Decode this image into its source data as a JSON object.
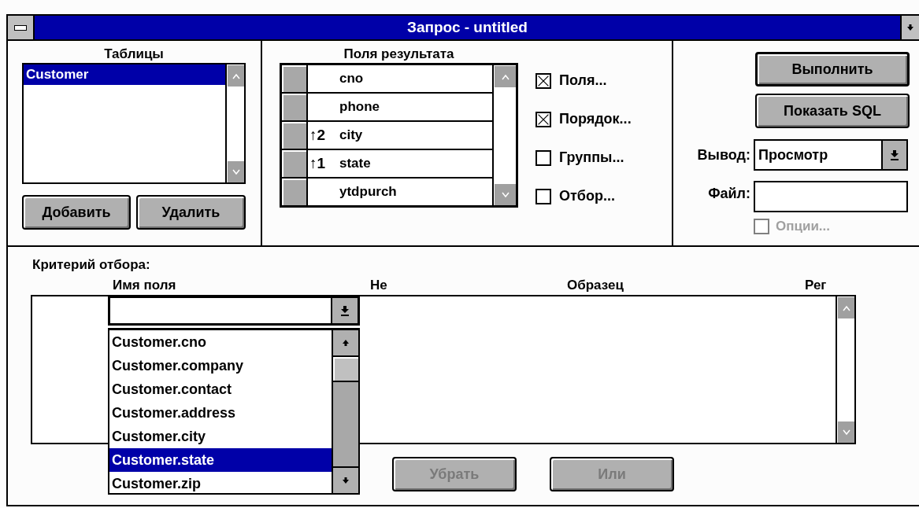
{
  "window": {
    "title": "Запрос - untitled"
  },
  "tables": {
    "label": "Таблицы",
    "items": [
      {
        "name": "Customer",
        "selected": true
      }
    ],
    "buttons": [
      {
        "label": "Добавить"
      },
      {
        "label": "Удалить"
      }
    ]
  },
  "result_fields": {
    "label": "Поля результата",
    "rows": [
      {
        "name": "cno"
      },
      {
        "name": "phone"
      },
      {
        "sort": "↑2",
        "name": "city"
      },
      {
        "sort": "↑1",
        "name": "state"
      },
      {
        "name": "ytdpurch"
      }
    ]
  },
  "options": [
    {
      "label": "Поля...",
      "checked": true
    },
    {
      "label": "Порядок...",
      "checked": true
    },
    {
      "label": "Группы...",
      "checked": false
    },
    {
      "label": "Отбор...",
      "checked": false
    }
  ],
  "actions": [
    {
      "label": "Выполнить",
      "default": true
    },
    {
      "label": "Показать SQL",
      "default": false
    }
  ],
  "output": {
    "label": "Вывод:",
    "value": "Просмотр"
  },
  "file": {
    "label": "Файл:"
  },
  "file_options": {
    "label": "Опции...",
    "checked": false,
    "disabled": true
  },
  "criteria": {
    "label": "Критерий отбора:",
    "columns": [
      "Имя поля",
      "Не",
      "Образец",
      "Рег"
    ],
    "field_dropdown": {
      "items": [
        {
          "text": "Customer.cno",
          "selected": false
        },
        {
          "text": "Customer.company",
          "selected": false
        },
        {
          "text": "Customer.contact",
          "selected": false
        },
        {
          "text": "Customer.address",
          "selected": false
        },
        {
          "text": "Customer.city",
          "selected": false
        },
        {
          "text": "Customer.state",
          "selected": true
        },
        {
          "text": "Customer.zip",
          "selected": false
        }
      ]
    },
    "buttons": [
      {
        "label": "Убрать",
        "disabled": true
      },
      {
        "label": "Или",
        "disabled": true
      }
    ]
  }
}
